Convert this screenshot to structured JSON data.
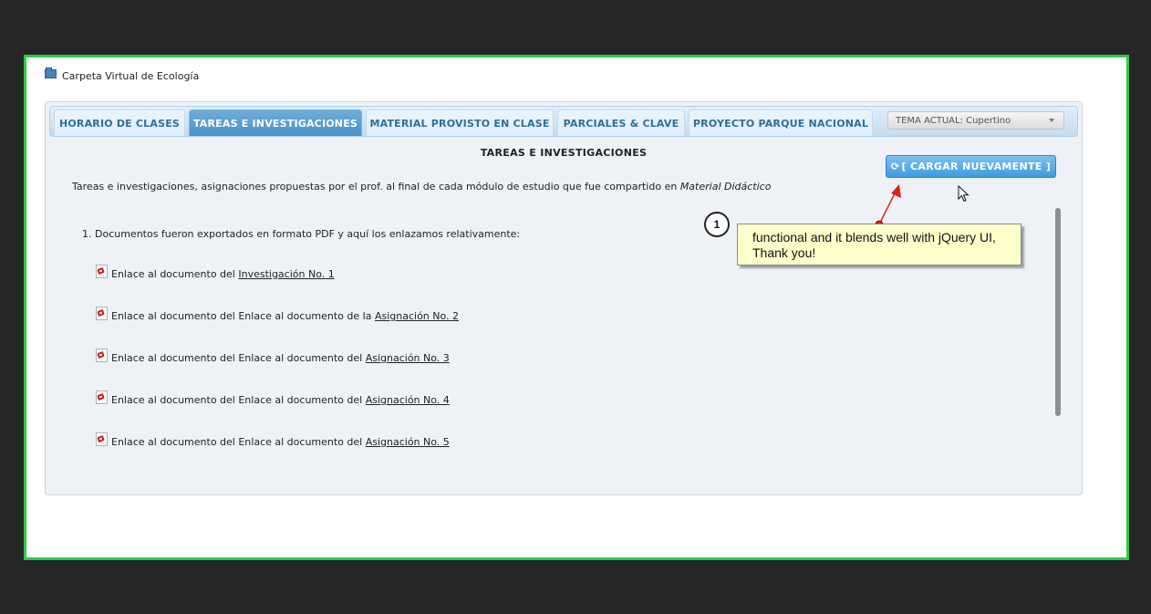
{
  "app": {
    "folder_title": "Carpeta Virtual de Ecología"
  },
  "tabs": [
    {
      "label": "HORARIO DE CLASES",
      "active": false
    },
    {
      "label": "TAREAS E INVESTIGACIONES",
      "active": true
    },
    {
      "label": "MATERIAL PROVISTO EN CLASE",
      "active": false
    },
    {
      "label": "PARCIALES & CLAVE",
      "active": false
    },
    {
      "label": "PROYECTO PARQUE NACIONAL",
      "active": false
    }
  ],
  "theme_select": {
    "value": "TEMA ACTUAL: Cupertino"
  },
  "content": {
    "title": "TAREAS E INVESTIGACIONES",
    "reload_button": "[  CARGAR NUEVAMENTE  ]",
    "description_text": "Tareas e investigaciones, asignaciones propuestas por el prof. al final de cada módulo de estudio que fue compartido en ",
    "description_emphasis": "Material Didáctico",
    "section_heading": "1. Documentos fueron exportados en formato PDF y aquí los enlazamos relativamente:",
    "documents": [
      {
        "prefix": "Enlace al documento del ",
        "link": "Investigación No. 1"
      },
      {
        "prefix": "Enlace al documento del Enlace al documento de la ",
        "link": "Asignación No. 2"
      },
      {
        "prefix": "Enlace al documento del Enlace al documento del ",
        "link": "Asignación No. 3"
      },
      {
        "prefix": "Enlace al documento del Enlace al documento del ",
        "link": "Asignación No. 4"
      },
      {
        "prefix": "Enlace al documento del Enlace al documento del ",
        "link": "Asignación No. 5"
      }
    ]
  },
  "annotation": {
    "step_number": "1",
    "callout_text": "functional and it blends well with jQuery UI, Thank you!"
  },
  "colors": {
    "frame_border": "#2ecc40",
    "active_tab": "#4a92c8",
    "tab_text": "#2e6e9e",
    "callout_bg": "#ffffcc",
    "arrow": "#e02020"
  },
  "icons": {
    "folder": "folder-icon",
    "pdf": "pdf-icon",
    "refresh": "refresh-icon",
    "cursor": "mouse-cursor-icon"
  }
}
